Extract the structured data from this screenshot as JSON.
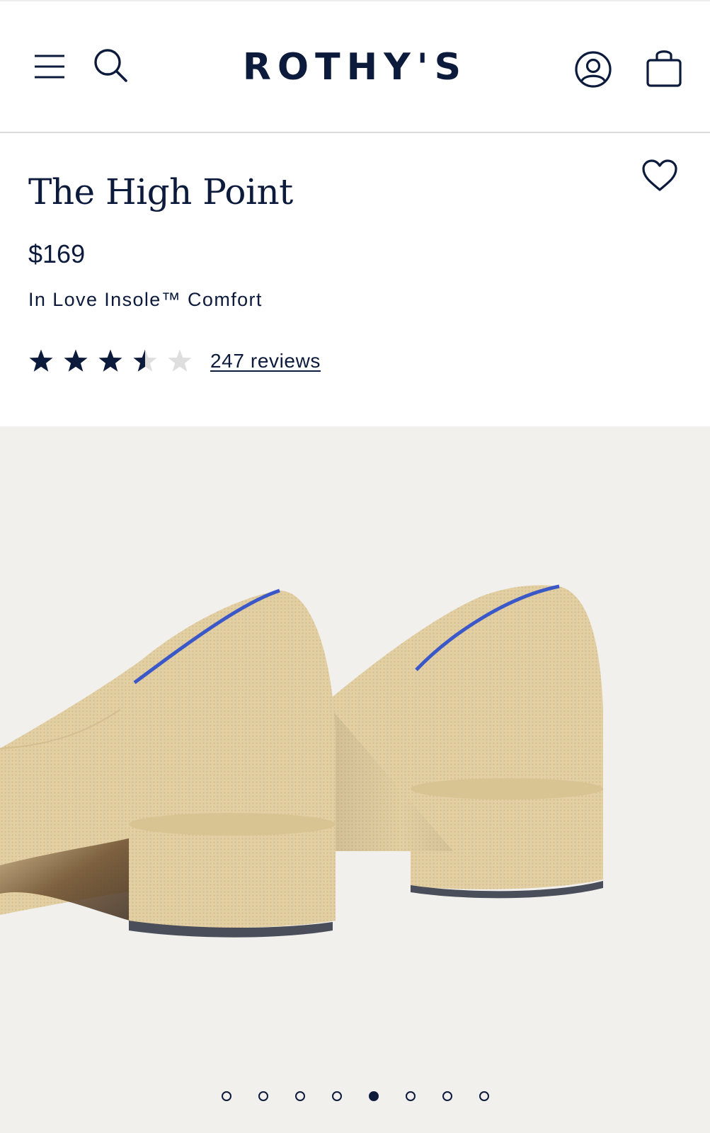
{
  "header": {
    "logo": "ROTHY'S",
    "icons": {
      "menu": "hamburger-menu-icon",
      "search": "search-icon",
      "account": "user-account-icon",
      "bag": "shopping-bag-icon"
    }
  },
  "product": {
    "title": "The High Point",
    "price": "$169",
    "subtitle": "In Love Insole™ Comfort",
    "rating": 3.5,
    "rating_max": 5,
    "reviews_label": "247 reviews",
    "favorite_icon": "heart-icon"
  },
  "gallery": {
    "image": "beige-knit-block-heel-shoes-rear-view",
    "slide_count": 8,
    "active_index": 4
  },
  "colors": {
    "navy": "#0c1a3c",
    "gallery_bg": "#f1f0ed",
    "star_empty": "#dedede",
    "shoe_knit": "#e4d2a8",
    "trim_blue": "#3a58c7"
  }
}
